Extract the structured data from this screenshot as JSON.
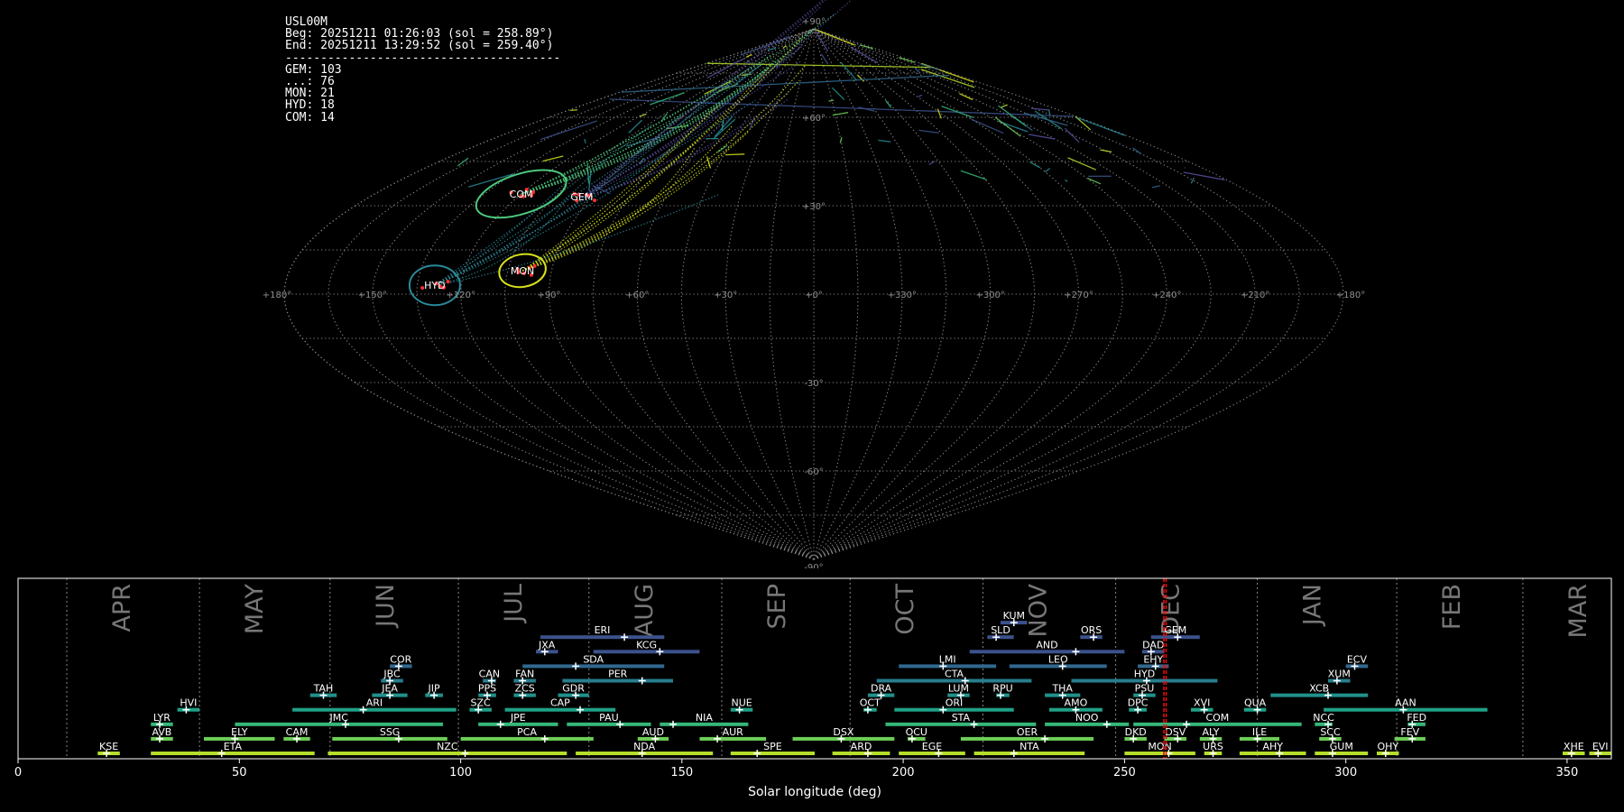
{
  "info_lines": [
    "USL00M",
    "Beg: 20251211 01:26:03 (sol = 258.89°)",
    "End: 20251211 13:29:52 (sol = 259.40°)",
    "---------------------------------------",
    "GEM: 103",
    "...: 76",
    "MON: 21",
    "HYD: 18",
    "COM: 14"
  ],
  "sky_map": {
    "projection": "sinusoidal",
    "lon_labels": [
      "+180°",
      "+150°",
      "+120°",
      "+90°",
      "+60°",
      "+30°",
      "+0°",
      "+330°",
      "+300°",
      "+270°",
      "+240°",
      "+210°",
      "+180°"
    ],
    "lat_labels": [
      "+90°",
      "+60°",
      "+30°",
      "-30°",
      "-60°",
      "-90°"
    ],
    "showers": [
      {
        "code": "COM",
        "ra": 120,
        "dec": 34,
        "rx": 26,
        "ry": 11,
        "tilt": -18,
        "color": "#4ec87d",
        "n": 14
      },
      {
        "code": "GEM",
        "ra": 94,
        "dec": 33,
        "rx": 0,
        "ry": 0,
        "tilt": 0,
        "color": "#5b4fa0",
        "n": 103
      },
      {
        "code": "MON",
        "ra": 100,
        "dec": 8,
        "rx": 13,
        "ry": 9,
        "tilt": -10,
        "color": "#d8e219",
        "n": 21
      },
      {
        "code": "HYD",
        "ra": 129,
        "dec": 3,
        "rx": 14,
        "ry": 11,
        "tilt": 0,
        "color": "#2a8a9a",
        "n": 18
      }
    ]
  },
  "chart_data": {
    "type": "timeline",
    "xlabel": "Solar longitude (deg)",
    "xlim": [
      0,
      360
    ],
    "xticks": [
      0,
      50,
      100,
      150,
      200,
      250,
      300,
      350
    ],
    "months": [
      {
        "label": "APR",
        "start": 11
      },
      {
        "label": "MAY",
        "start": 41
      },
      {
        "label": "JUN",
        "start": 70.5
      },
      {
        "label": "JUL",
        "start": 99.5
      },
      {
        "label": "AUG",
        "start": 129
      },
      {
        "label": "SEP",
        "start": 159
      },
      {
        "label": "OCT",
        "start": 188
      },
      {
        "label": "NOV",
        "start": 218
      },
      {
        "label": "DEC",
        "start": 248
      },
      {
        "label": "JAN",
        "start": 280
      },
      {
        "label": "FEB",
        "start": 311.5
      },
      {
        "label": "MAR",
        "start": 340
      }
    ],
    "observation_sol": [
      258.89,
      259.4
    ],
    "showers": [
      {
        "code": "KUM",
        "start": 222,
        "end": 228,
        "peak": 225,
        "row": 9,
        "color": "#3b528b"
      },
      {
        "code": "ERI",
        "start": 118,
        "end": 146,
        "peak": 137,
        "row": 8,
        "color": "#3b528b"
      },
      {
        "code": "SLD",
        "start": 219,
        "end": 225,
        "peak": 221,
        "row": 8,
        "color": "#3b528b"
      },
      {
        "code": "ORS",
        "start": 240,
        "end": 245,
        "peak": 243,
        "row": 8,
        "color": "#3b528b"
      },
      {
        "code": "GEM",
        "start": 256,
        "end": 267,
        "peak": 262,
        "row": 8,
        "color": "#3b528b"
      },
      {
        "code": "JXA",
        "start": 117,
        "end": 122,
        "peak": 119,
        "row": 7,
        "color": "#3b528b"
      },
      {
        "code": "KCG",
        "start": 130,
        "end": 154,
        "peak": 145,
        "row": 7,
        "color": "#3b528b"
      },
      {
        "code": "AND",
        "start": 215,
        "end": 250,
        "peak": 239,
        "row": 7,
        "color": "#3b528b"
      },
      {
        "code": "DAD",
        "start": 254,
        "end": 259,
        "peak": 256,
        "row": 7,
        "color": "#3b528b"
      },
      {
        "code": "COR",
        "start": 84,
        "end": 89,
        "peak": 86,
        "row": 6,
        "color": "#31688e"
      },
      {
        "code": "SDA",
        "start": 114,
        "end": 146,
        "peak": 126,
        "row": 6,
        "color": "#31688e"
      },
      {
        "code": "LMI",
        "start": 199,
        "end": 221,
        "peak": 209,
        "row": 6,
        "color": "#31688e"
      },
      {
        "code": "LEO",
        "start": 224,
        "end": 246,
        "peak": 236,
        "row": 6,
        "color": "#31688e"
      },
      {
        "code": "EHY",
        "start": 253,
        "end": 260,
        "peak": 257,
        "row": 6,
        "color": "#31688e"
      },
      {
        "code": "ECV",
        "start": 300,
        "end": 305,
        "peak": 302,
        "row": 6,
        "color": "#31688e"
      },
      {
        "code": "JBC",
        "start": 82,
        "end": 87,
        "peak": 84,
        "row": 5,
        "color": "#287d8e"
      },
      {
        "code": "CAN",
        "start": 105,
        "end": 108,
        "peak": 107,
        "row": 5,
        "color": "#287d8e"
      },
      {
        "code": "FAN",
        "start": 112,
        "end": 117,
        "peak": 114,
        "row": 5,
        "color": "#287d8e"
      },
      {
        "code": "PER",
        "start": 123,
        "end": 148,
        "peak": 141,
        "row": 5,
        "color": "#287d8e"
      },
      {
        "code": "CTA",
        "start": 194,
        "end": 229,
        "peak": 214,
        "row": 5,
        "color": "#287d8e"
      },
      {
        "code": "HYD",
        "start": 238,
        "end": 271,
        "peak": 255,
        "row": 5,
        "color": "#287d8e"
      },
      {
        "code": "XUM",
        "start": 296,
        "end": 301,
        "peak": 298,
        "row": 5,
        "color": "#287d8e"
      },
      {
        "code": "TAH",
        "start": 66,
        "end": 72,
        "peak": 69,
        "row": 4,
        "color": "#21918c"
      },
      {
        "code": "JEA",
        "start": 80,
        "end": 88,
        "peak": 84,
        "row": 4,
        "color": "#21918c"
      },
      {
        "code": "JIP",
        "start": 92,
        "end": 96,
        "peak": 94,
        "row": 4,
        "color": "#21918c"
      },
      {
        "code": "PPS",
        "start": 104,
        "end": 108,
        "peak": 106,
        "row": 4,
        "color": "#21918c"
      },
      {
        "code": "ZCS",
        "start": 112,
        "end": 117,
        "peak": 114,
        "row": 4,
        "color": "#21918c"
      },
      {
        "code": "GDR",
        "start": 122,
        "end": 129,
        "peak": 126,
        "row": 4,
        "color": "#21918c"
      },
      {
        "code": "DRA",
        "start": 192,
        "end": 198,
        "peak": 195,
        "row": 4,
        "color": "#21918c"
      },
      {
        "code": "LUM",
        "start": 210,
        "end": 215,
        "peak": 213,
        "row": 4,
        "color": "#21918c"
      },
      {
        "code": "RPU",
        "start": 221,
        "end": 224,
        "peak": 222,
        "row": 4,
        "color": "#21918c"
      },
      {
        "code": "THA",
        "start": 232,
        "end": 240,
        "peak": 236,
        "row": 4,
        "color": "#21918c"
      },
      {
        "code": "PSU",
        "start": 252,
        "end": 257,
        "peak": 254,
        "row": 4,
        "color": "#21918c"
      },
      {
        "code": "XCB",
        "start": 283,
        "end": 305,
        "peak": 296,
        "row": 4,
        "color": "#21918c"
      },
      {
        "code": "HVI",
        "start": 36,
        "end": 41,
        "peak": 38,
        "row": 3,
        "color": "#1fa187"
      },
      {
        "code": "ARI",
        "start": 62,
        "end": 99,
        "peak": 78,
        "row": 3,
        "color": "#1fa187"
      },
      {
        "code": "SZC",
        "start": 102,
        "end": 107,
        "peak": 104,
        "row": 3,
        "color": "#1fa187"
      },
      {
        "code": "CAP",
        "start": 110,
        "end": 135,
        "peak": 127,
        "row": 3,
        "color": "#1fa187"
      },
      {
        "code": "NUE",
        "start": 161,
        "end": 166,
        "peak": 163,
        "row": 3,
        "color": "#1fa187"
      },
      {
        "code": "OCT",
        "start": 191,
        "end": 194,
        "peak": 192,
        "row": 3,
        "color": "#1fa187"
      },
      {
        "code": "ORI",
        "start": 198,
        "end": 225,
        "peak": 209,
        "row": 3,
        "color": "#1fa187"
      },
      {
        "code": "AMO",
        "start": 233,
        "end": 245,
        "peak": 239,
        "row": 3,
        "color": "#1fa187"
      },
      {
        "code": "DPC",
        "start": 251,
        "end": 255,
        "peak": 253,
        "row": 3,
        "color": "#1fa187"
      },
      {
        "code": "XVI",
        "start": 265,
        "end": 270,
        "peak": 268,
        "row": 3,
        "color": "#1fa187"
      },
      {
        "code": "QUA",
        "start": 277,
        "end": 282,
        "peak": 280,
        "row": 3,
        "color": "#1fa187"
      },
      {
        "code": "AAN",
        "start": 295,
        "end": 332,
        "peak": 313,
        "row": 3,
        "color": "#1fa187"
      },
      {
        "code": "LYR",
        "start": 30,
        "end": 35,
        "peak": 32,
        "row": 2,
        "color": "#35b779"
      },
      {
        "code": "JMC",
        "start": 49,
        "end": 96,
        "peak": 74,
        "row": 2,
        "color": "#35b779"
      },
      {
        "code": "JPE",
        "start": 104,
        "end": 122,
        "peak": 109,
        "row": 2,
        "color": "#35b779"
      },
      {
        "code": "PAU",
        "start": 124,
        "end": 143,
        "peak": 136,
        "row": 2,
        "color": "#35b779"
      },
      {
        "code": "NIA",
        "start": 145,
        "end": 165,
        "peak": 148,
        "row": 2,
        "color": "#35b779"
      },
      {
        "code": "STA",
        "start": 196,
        "end": 230,
        "peak": 216,
        "row": 2,
        "color": "#35b779"
      },
      {
        "code": "NOO",
        "start": 232,
        "end": 251,
        "peak": 246,
        "row": 2,
        "color": "#35b779"
      },
      {
        "code": "COM",
        "start": 252,
        "end": 290,
        "peak": 264,
        "row": 2,
        "color": "#35b779"
      },
      {
        "code": "NCC",
        "start": 293,
        "end": 297,
        "peak": 296,
        "row": 2,
        "color": "#35b779"
      },
      {
        "code": "FED",
        "start": 314,
        "end": 318,
        "peak": 315,
        "row": 2,
        "color": "#35b779"
      },
      {
        "code": "AVB",
        "start": 30,
        "end": 35,
        "peak": 32,
        "row": 1,
        "color": "#6ece58"
      },
      {
        "code": "ELY",
        "start": 42,
        "end": 58,
        "peak": 49,
        "row": 1,
        "color": "#6ece58"
      },
      {
        "code": "CAM",
        "start": 60,
        "end": 66,
        "peak": 63,
        "row": 1,
        "color": "#6ece58"
      },
      {
        "code": "SSG",
        "start": 71,
        "end": 97,
        "peak": 86,
        "row": 1,
        "color": "#6ece58"
      },
      {
        "code": "PCA",
        "start": 100,
        "end": 130,
        "peak": 119,
        "row": 1,
        "color": "#6ece58"
      },
      {
        "code": "AUD",
        "start": 140,
        "end": 147,
        "peak": 144,
        "row": 1,
        "color": "#6ece58"
      },
      {
        "code": "AUR",
        "start": 154,
        "end": 169,
        "peak": 158,
        "row": 1,
        "color": "#6ece58"
      },
      {
        "code": "DSX",
        "start": 175,
        "end": 198,
        "peak": 186,
        "row": 1,
        "color": "#6ece58"
      },
      {
        "code": "OCU",
        "start": 201,
        "end": 205,
        "peak": 202,
        "row": 1,
        "color": "#6ece58"
      },
      {
        "code": "OER",
        "start": 213,
        "end": 243,
        "peak": 232,
        "row": 1,
        "color": "#6ece58"
      },
      {
        "code": "DKD",
        "start": 250,
        "end": 255,
        "peak": 252,
        "row": 1,
        "color": "#6ece58"
      },
      {
        "code": "DSV",
        "start": 259,
        "end": 264,
        "peak": 262,
        "row": 1,
        "color": "#6ece58"
      },
      {
        "code": "ALY",
        "start": 267,
        "end": 272,
        "peak": 270,
        "row": 1,
        "color": "#6ece58"
      },
      {
        "code": "ILE",
        "start": 276,
        "end": 285,
        "peak": 280,
        "row": 1,
        "color": "#6ece58"
      },
      {
        "code": "SCC",
        "start": 294,
        "end": 299,
        "peak": 297,
        "row": 1,
        "color": "#6ece58"
      },
      {
        "code": "FEV",
        "start": 311,
        "end": 318,
        "peak": 315,
        "row": 1,
        "color": "#6ece58"
      },
      {
        "code": "KSE",
        "start": 18,
        "end": 23,
        "peak": 20,
        "row": 0,
        "color": "#b5de2b"
      },
      {
        "code": "ETA",
        "start": 30,
        "end": 67,
        "peak": 46,
        "row": 0,
        "color": "#b5de2b"
      },
      {
        "code": "NZC",
        "start": 70,
        "end": 124,
        "peak": 101,
        "row": 0,
        "color": "#b5de2b"
      },
      {
        "code": "NDA",
        "start": 126,
        "end": 157,
        "peak": 141,
        "row": 0,
        "color": "#b5de2b"
      },
      {
        "code": "SPE",
        "start": 161,
        "end": 180,
        "peak": 167,
        "row": 0,
        "color": "#b5de2b"
      },
      {
        "code": "ARD",
        "start": 184,
        "end": 197,
        "peak": 192,
        "row": 0,
        "color": "#b5de2b"
      },
      {
        "code": "EGE",
        "start": 199,
        "end": 214,
        "peak": 208,
        "row": 0,
        "color": "#b5de2b"
      },
      {
        "code": "NTA",
        "start": 216,
        "end": 241,
        "peak": 225,
        "row": 0,
        "color": "#b5de2b"
      },
      {
        "code": "MON",
        "start": 250,
        "end": 266,
        "peak": 260,
        "row": 0,
        "color": "#b5de2b"
      },
      {
        "code": "URS",
        "start": 268,
        "end": 272,
        "peak": 270,
        "row": 0,
        "color": "#b5de2b"
      },
      {
        "code": "AHY",
        "start": 276,
        "end": 291,
        "peak": 285,
        "row": 0,
        "color": "#b5de2b"
      },
      {
        "code": "GUM",
        "start": 293,
        "end": 305,
        "peak": 297,
        "row": 0,
        "color": "#b5de2b"
      },
      {
        "code": "OHY",
        "start": 307,
        "end": 312,
        "peak": 309,
        "row": 0,
        "color": "#b5de2b"
      },
      {
        "code": "XHE",
        "start": 349,
        "end": 354,
        "peak": 351,
        "row": 0,
        "color": "#b5de2b"
      },
      {
        "code": "EVI",
        "start": 355,
        "end": 360,
        "peak": 357,
        "row": 0,
        "color": "#b5de2b"
      }
    ]
  }
}
